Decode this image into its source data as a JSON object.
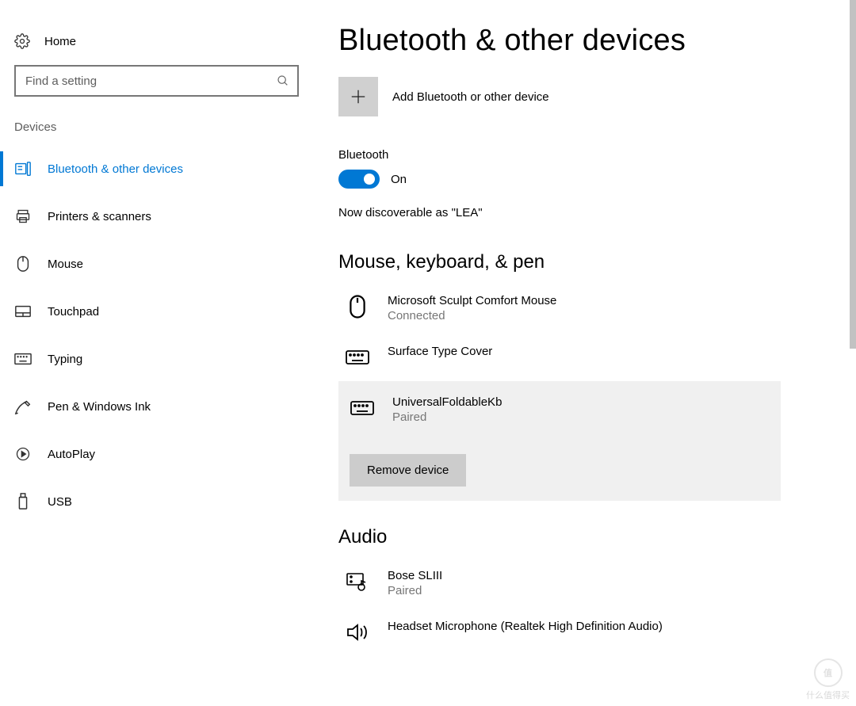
{
  "sidebar": {
    "home": "Home",
    "search_placeholder": "Find a setting",
    "section": "Devices",
    "items": [
      {
        "label": "Bluetooth & other devices",
        "active": true
      },
      {
        "label": "Printers & scanners"
      },
      {
        "label": "Mouse"
      },
      {
        "label": "Touchpad"
      },
      {
        "label": "Typing"
      },
      {
        "label": "Pen & Windows Ink"
      },
      {
        "label": "AutoPlay"
      },
      {
        "label": "USB"
      }
    ]
  },
  "page": {
    "title": "Bluetooth & other devices",
    "add_label": "Add Bluetooth or other device",
    "bluetooth_label": "Bluetooth",
    "bluetooth_state": "On",
    "discoverable_text": "Now discoverable as \"LEA\""
  },
  "groups": [
    {
      "title": "Mouse, keyboard, & pen",
      "devices": [
        {
          "name": "Microsoft Sculpt Comfort Mouse",
          "status": "Connected",
          "icon": "mouse"
        },
        {
          "name": "Surface Type Cover",
          "status": "",
          "icon": "keyboard"
        },
        {
          "name": "UniversalFoldableKb",
          "status": "Paired",
          "icon": "keyboard",
          "selected": true
        }
      ]
    },
    {
      "title": "Audio",
      "devices": [
        {
          "name": "Bose SLIII",
          "status": "Paired",
          "icon": "audio-device"
        },
        {
          "name": "Headset Microphone (Realtek High Definition Audio)",
          "status": "",
          "icon": "speaker"
        }
      ]
    }
  ],
  "actions": {
    "remove_device": "Remove device"
  },
  "watermark": "什么值得买"
}
